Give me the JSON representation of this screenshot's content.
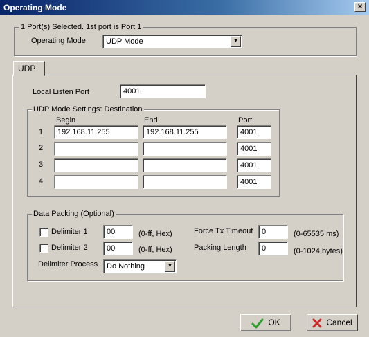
{
  "window": {
    "title": "Operating Mode",
    "close_glyph": "×"
  },
  "port_group": {
    "title": "1 Port(s) Selected. 1st port is Port 1",
    "mode_label": "Operating Mode",
    "mode_value": "UDP Mode"
  },
  "tab": {
    "label": "UDP"
  },
  "local_listen": {
    "label": "Local Listen Port",
    "value": "4001"
  },
  "destination": {
    "title": "UDP Mode Settings: Destination",
    "col_begin": "Begin",
    "col_end": "End",
    "col_port": "Port",
    "rows": [
      {
        "index": "1",
        "begin": "192.168.11.255",
        "end": "192.168.11.255",
        "port": "4001"
      },
      {
        "index": "2",
        "begin": "",
        "end": "",
        "port": "4001"
      },
      {
        "index": "3",
        "begin": "",
        "end": "",
        "port": "4001"
      },
      {
        "index": "4",
        "begin": "",
        "end": "",
        "port": "4001"
      }
    ]
  },
  "packing": {
    "title": "Data Packing (Optional)",
    "delimiter1": {
      "label": "Delimiter 1",
      "value": "00",
      "hint": "(0-ff, Hex)"
    },
    "delimiter2": {
      "label": "Delimiter 2",
      "value": "00",
      "hint": "(0-ff, Hex)"
    },
    "process": {
      "label": "Delimiter Process",
      "value": "Do Nothing"
    },
    "force_tx": {
      "label": "Force Tx Timeout",
      "value": "0",
      "hint": "(0-65535 ms)"
    },
    "packing_length": {
      "label": "Packing Length",
      "value": "0",
      "hint": "(0-1024 bytes)"
    }
  },
  "buttons": {
    "ok": "OK",
    "cancel": "Cancel"
  },
  "colors": {
    "title_start": "#0a246a",
    "title_end": "#a6caf0",
    "ok_icon": "#2e9e2e",
    "cancel_icon": "#c62828"
  },
  "icons": {
    "ok": "check-icon",
    "cancel": "x-icon",
    "dropdown": "chevron-down-icon"
  }
}
